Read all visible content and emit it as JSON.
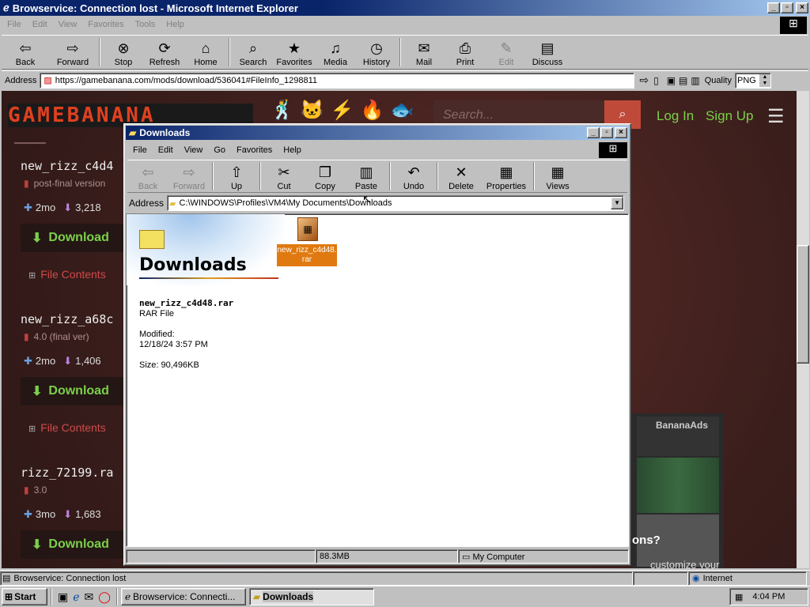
{
  "ie": {
    "title": "Browservice: Connection lost - Microsoft Internet Explorer",
    "menu": [
      "File",
      "Edit",
      "View",
      "Favorites",
      "Tools",
      "Help"
    ],
    "toolbar": [
      {
        "label": "Back",
        "icon": "back-arrow-icon"
      },
      {
        "label": "Forward",
        "icon": "forward-arrow-icon"
      },
      {
        "label": "Stop",
        "icon": "stop-icon"
      },
      {
        "label": "Refresh",
        "icon": "refresh-icon"
      },
      {
        "label": "Home",
        "icon": "home-icon"
      },
      {
        "label": "Search",
        "icon": "search-icon"
      },
      {
        "label": "Favorites",
        "icon": "favorites-icon"
      },
      {
        "label": "Media",
        "icon": "media-icon"
      },
      {
        "label": "History",
        "icon": "history-icon"
      },
      {
        "label": "Mail",
        "icon": "mail-icon"
      },
      {
        "label": "Print",
        "icon": "print-icon"
      },
      {
        "label": "Edit",
        "icon": "edit-icon"
      },
      {
        "label": "Discuss",
        "icon": "discuss-icon"
      }
    ],
    "address_label": "Address",
    "url": "https://gamebanana.com/mods/download/536041#FileInfo_1298811",
    "quality_label": "Quality",
    "quality_value": "PNG",
    "status": "Browservice: Connection lost",
    "zone": "Internet"
  },
  "site": {
    "search_placeholder": "Search...",
    "login": "Log In",
    "signup": "Sign Up",
    "files": [
      {
        "name": "new_rizz_c4d4",
        "version": "post-final version",
        "age": "2mo",
        "downloads": "3,218"
      },
      {
        "name": "new_rizz_a68c",
        "version": "4.0 (final ver)",
        "age": "2mo",
        "downloads": "1,406"
      },
      {
        "name": "rizz_72199.ra",
        "version": "3.0",
        "age": "3mo",
        "downloads": "1,683"
      }
    ],
    "download_label": "Download",
    "contents_label": "File Contents",
    "ads_label": "BananaAds",
    "ad_text": "ons?",
    "ad_text2": "customize your"
  },
  "explorer": {
    "title": "Downloads",
    "menu": [
      "File",
      "Edit",
      "View",
      "Go",
      "Favorites",
      "Help"
    ],
    "toolbar": [
      {
        "label": "Back",
        "icon": "back-arrow-icon",
        "disabled": true
      },
      {
        "label": "Forward",
        "icon": "forward-arrow-icon",
        "disabled": true
      },
      {
        "label": "Up",
        "icon": "up-folder-icon"
      },
      {
        "label": "Cut",
        "icon": "cut-icon"
      },
      {
        "label": "Copy",
        "icon": "copy-icon"
      },
      {
        "label": "Paste",
        "icon": "paste-icon"
      },
      {
        "label": "Undo",
        "icon": "undo-icon"
      },
      {
        "label": "Delete",
        "icon": "delete-icon"
      },
      {
        "label": "Properties",
        "icon": "properties-icon"
      },
      {
        "label": "Views",
        "icon": "views-icon"
      }
    ],
    "address_label": "Address",
    "path": "C:\\WINDOWS\\Profiles\\VM4\\My Documents\\Downloads",
    "folder_title": "Downloads",
    "selected": {
      "name": "new_rizz_c4d48.rar",
      "type": "RAR File",
      "modified_label": "Modified:",
      "modified": "12/18/24 3:57 PM",
      "size": "Size: 90,496KB"
    },
    "file_label": "new_rizz_c4d48.rar",
    "status_size": "88.3MB",
    "status_location": "My Computer"
  },
  "taskbar": {
    "start": "Start",
    "tasks": [
      "Browservice: Connecti...",
      "Downloads"
    ],
    "time": "4:04 PM"
  },
  "colors": {
    "titlebar": "#0a246a",
    "site_bg": "#3a1e1c",
    "download_green": "#7bd04a",
    "selection": "#e07a10"
  }
}
